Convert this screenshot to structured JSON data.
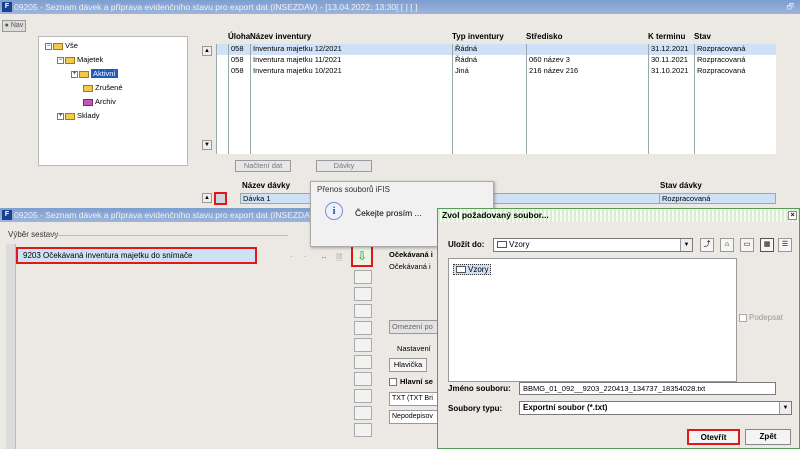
{
  "window1": {
    "title": "09205 - Seznam dávek a příprava evidenčního stavu pro export dat (INSEZDAV) - [13.04.2022; 13:30[ [ ] [ ]",
    "nav_label": "Nav",
    "tree": {
      "items": [
        "Vše",
        "Majetek",
        "Aktivní",
        "Zrušené",
        "Archiv",
        "Sklady"
      ]
    },
    "grid": {
      "columns": [
        "Úloha",
        "Název inventury",
        "Typ inventury",
        "Středisko",
        "K terminu",
        "Stav"
      ],
      "rows": [
        [
          "058",
          "Inventura majetku 12/2021",
          "Řádná",
          "",
          "31.12.2021",
          "Rozpracovaná"
        ],
        [
          "058",
          "Inventura majetku 11/2021",
          "Řádná",
          "060 název 3",
          "30.11.2021",
          "Rozpracovaná"
        ],
        [
          "058",
          "Inventura majetku 10/2021",
          "Jiná",
          "216 název 216",
          "31.10.2021",
          "Rozpracovaná"
        ]
      ]
    },
    "buttons": {
      "load": "Načtení dat",
      "batches": "Dávky"
    },
    "batch": {
      "col_name": "Název dávky",
      "col_state": "Stav dávky",
      "row_name": "Dávka 1",
      "row_state": "Rozpracovaná"
    }
  },
  "window2": {
    "title": "09205 - Seznam dávek a příprava evidenčního stavu pro export dat (INSEZDAV) - [13.04.2022; 13:30[ [ ] [ ]",
    "section": "Výběr sestavy",
    "report_code": "9203",
    "report_name": "Očekávaná inventura majetku do snímače",
    "right": {
      "label1": "Očekávaná i",
      "label2": "Očekávaná i",
      "omezeni": "Omezení po",
      "nastaveni": "Nastavení",
      "hlavicka": "Hlavička",
      "hlavni": "Hlavní se",
      "txt": "TXT (TXT Bri",
      "nepodepis": "Nepodepisov"
    }
  },
  "progress": {
    "title": "Přenos souborů iFIS",
    "message": "Čekejte prosím ..."
  },
  "file_dialog": {
    "title": "Zvol požadovaný soubor...",
    "save_in_label": "Uložit do:",
    "save_in_value": "Vzory",
    "folder_item": "Vzory",
    "sign_label": "Podepsat",
    "filename_label": "Jméno souboru:",
    "filename_value": "BBMG_01_092__9203_220413_134737_18354028.txt",
    "filetype_label": "Soubory typu:",
    "filetype_value": "Exportní soubor (*.txt)",
    "open_button": "Otevřít",
    "back_button": "Zpět"
  }
}
